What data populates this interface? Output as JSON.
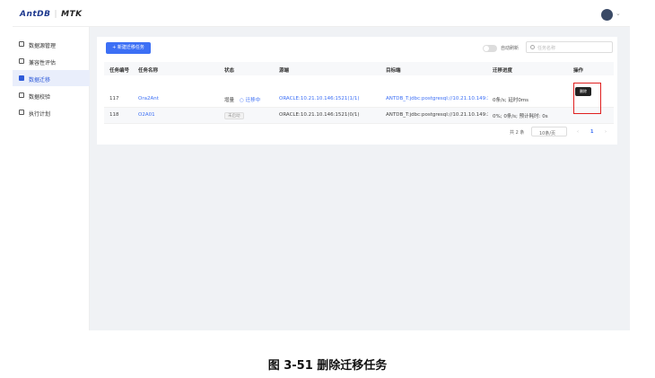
{
  "app": {
    "logo_main": "AntDB",
    "logo_sub": "MTK"
  },
  "sidebar": {
    "items": [
      {
        "label": "数据源管理"
      },
      {
        "label": "兼容性评估"
      },
      {
        "label": "数据迁移"
      },
      {
        "label": "数据校验"
      },
      {
        "label": "执行计划"
      }
    ]
  },
  "toolbar": {
    "new_task_label": "+ 新建迁移任务",
    "auto_refresh_label": "自动刷新",
    "search_placeholder": "任务名称"
  },
  "table": {
    "headers": [
      "任务编号",
      "任务名称",
      "状态",
      "源端",
      "目标端",
      "迁移进度",
      "操作"
    ],
    "rows": [
      {
        "id": "117",
        "name": "Ora2Ant",
        "status_mode": "增量",
        "status_text": "迁移中",
        "source": "ORACLE:10.21.10.146:1521(1/1)",
        "target": "ANTDB_T:jdbc:postgresql://10.21.10.149:3333/",
        "progress": "0条/s; 延时0ms"
      },
      {
        "id": "118",
        "name": "O2A01",
        "status_badge": "未启动",
        "source": "ORACLE:10.21.10.146:1521(0/1)",
        "target": "ANTDB_T:jdbc:postgresql://10.21.10.149:3333/",
        "progress": "0%; 0条/s; 预计耗时: 0s"
      }
    ]
  },
  "tooltip": {
    "delete": "删除"
  },
  "pagination": {
    "total": "共 2 条",
    "page_size": "10条/页",
    "prev": "‹",
    "current": "1",
    "next": "›"
  },
  "caption": "图 3-51  删除迁移任务",
  "colors": {
    "accent": "#3c6ff5",
    "highlight": "#e02020"
  }
}
